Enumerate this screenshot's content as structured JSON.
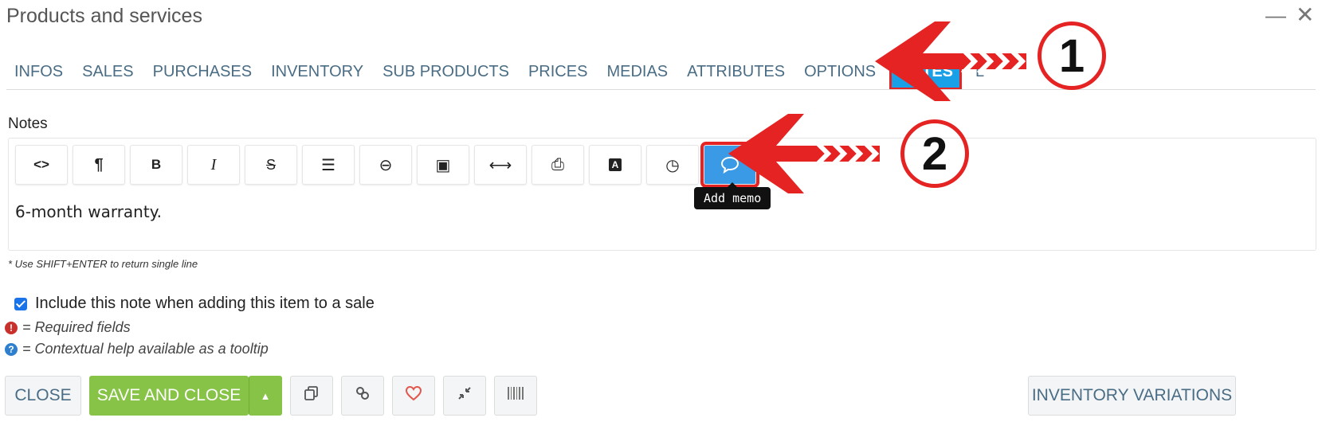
{
  "window": {
    "title": "Products and services",
    "minimize_glyph": "—",
    "close_glyph": "✕"
  },
  "tabs": [
    {
      "label": "INFOS"
    },
    {
      "label": "SALES"
    },
    {
      "label": "PURCHASES"
    },
    {
      "label": "INVENTORY"
    },
    {
      "label": "SUB PRODUCTS"
    },
    {
      "label": "PRICES"
    },
    {
      "label": "MEDIAS"
    },
    {
      "label": "ATTRIBUTES"
    },
    {
      "label": "OPTIONS"
    },
    {
      "label": "NOTES"
    },
    {
      "label": "L"
    }
  ],
  "active_tab": "NOTES",
  "notes": {
    "label": "Notes",
    "content": "6-month warranty.",
    "toolbar": [
      {
        "name": "code-view",
        "glyph": "<>"
      },
      {
        "name": "paragraph",
        "glyph": "¶"
      },
      {
        "name": "bold",
        "glyph": "B"
      },
      {
        "name": "italic",
        "glyph": "I"
      },
      {
        "name": "strikethrough",
        "glyph": "S"
      },
      {
        "name": "list",
        "glyph": "☰"
      },
      {
        "name": "link",
        "glyph": "⊖"
      },
      {
        "name": "image",
        "glyph": "▣"
      },
      {
        "name": "horizontal-rule",
        "glyph": "⟷"
      },
      {
        "name": "print",
        "glyph": "⎙"
      },
      {
        "name": "font",
        "glyph": "A"
      },
      {
        "name": "clock",
        "glyph": "◷"
      },
      {
        "name": "add-memo",
        "glyph": "💬"
      }
    ],
    "tooltip": "Add memo",
    "hint": "* Use SHIFT+ENTER to return single line"
  },
  "include_note": {
    "label": "Include this note when adding this item to a sale",
    "checked": true
  },
  "legend": {
    "required": "= Required fields",
    "help": "= Contextual help available as a tooltip",
    "required_glyph": "!",
    "help_glyph": "?"
  },
  "footer": {
    "close": "CLOSE",
    "save_close": "SAVE AND CLOSE",
    "caret_glyph": "▲",
    "inventory_variations": "INVENTORY VARIATIONS"
  },
  "annotations": {
    "step1": "1",
    "step2": "2"
  },
  "colors": {
    "accent_tab": "#1aa0e6",
    "highlight_red": "#e52323",
    "save_green": "#86c346",
    "tab_text": "#4a6d85"
  }
}
